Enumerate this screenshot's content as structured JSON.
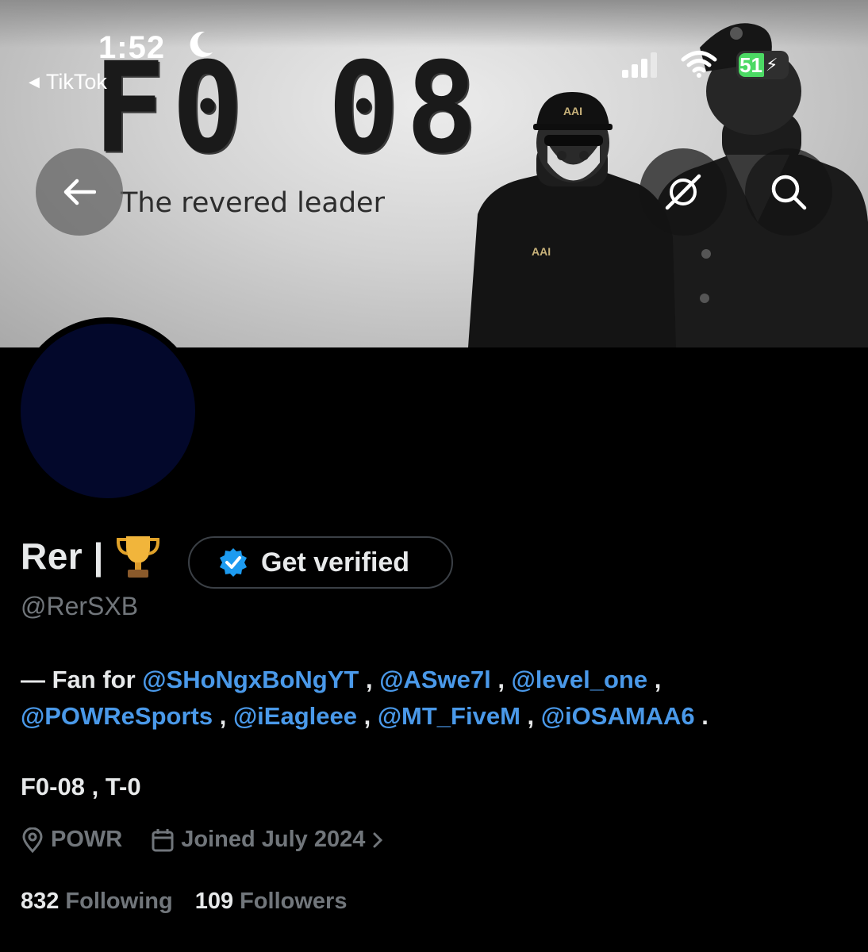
{
  "status_bar": {
    "time": "1:52",
    "back_app": "TikTok",
    "battery_level": "51",
    "moon_icon": "moon-icon",
    "signal_icon": "signal-icon",
    "wifi_icon": "wifi-icon"
  },
  "banner": {
    "title": "F0 08",
    "subtitle": "The revered leader",
    "cap_text": "AAI",
    "jacket_text": "AAI"
  },
  "header_actions": {
    "back_icon": "arrow-left-icon",
    "grok_icon": "grok-icon",
    "search_icon": "search-icon"
  },
  "profile": {
    "display_name": "Rer |",
    "name_emoji": "trophy-icon",
    "get_verified_label": "Get verified",
    "handle": "@RerSXB",
    "bio": {
      "prefix": "— Fan for",
      "mentions": [
        "@SHoNgxBoNgYT",
        "@ASwe7l",
        "@level_one",
        "@POWReSports",
        "@iEagleee",
        "@MT_FiveM",
        "@iOSAMAA6"
      ],
      "separator": " , ",
      "suffix": " .",
      "line2": "F0-08 , T-0"
    },
    "location": "POWR",
    "joined": "Joined July 2024",
    "following_count": "832",
    "following_label": "Following",
    "followers_count": "109",
    "followers_label": "Followers"
  },
  "colors": {
    "accent": "#4a99e9",
    "avatar": "#03082b",
    "battery": "#4cd964",
    "muted_text": "#71767b"
  }
}
